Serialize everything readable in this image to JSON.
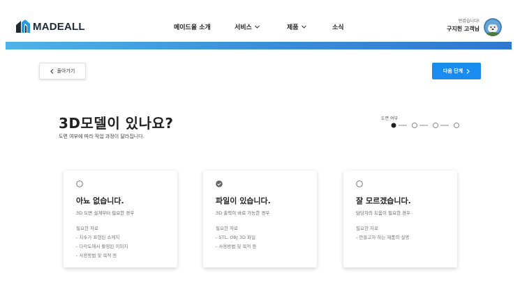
{
  "header": {
    "logo_text": "MADEALL",
    "nav": [
      {
        "label": "메이드올 소개",
        "has_dropdown": false
      },
      {
        "label": "서비스",
        "has_dropdown": true
      },
      {
        "label": "제품",
        "has_dropdown": true
      },
      {
        "label": "소식",
        "has_dropdown": false
      }
    ],
    "user": {
      "greeting": "반갑습니다!",
      "name": "구지헌 고객님"
    }
  },
  "actions": {
    "back_label": "돌아가기",
    "next_label": "다음 단계"
  },
  "main": {
    "title": "3D모델이 있나요?",
    "subtitle": "도면 여부에 따라 작업 과정이 달라집니다."
  },
  "stepper": {
    "label": "도면 여부",
    "total_steps": 4,
    "current_step": 1
  },
  "options": [
    {
      "selected": false,
      "title": "아뇨 없습니다.",
      "desc": "3D 도면 설계부터 필요한 경우",
      "req_label": "필요한 자료",
      "req_items": [
        "- 치수가 표현된 스케치",
        "- 다각도에서 촬영된 이미지",
        "- 사용방법 및 목적 등"
      ]
    },
    {
      "selected": true,
      "title": "파일이 있습니다.",
      "desc": "3D 출력이 바로 가능한 경우",
      "req_label": "필요한 자료",
      "req_items": [
        "- STL, OBJ 3D 파일",
        "- 사용방법 및 목적 등"
      ]
    },
    {
      "selected": false,
      "title": "잘 모르겠습니다.",
      "desc": "담당자의 도움이 필요한 경우",
      "req_label": "필요한 자료",
      "req_items": [
        "- 만들고자 하는 제품의 설명"
      ]
    }
  ],
  "colors": {
    "accent": "#1a8cf0",
    "bar_start": "#4fb3e8",
    "bar_end": "#2f78d0",
    "logo": "#1e2a36"
  }
}
